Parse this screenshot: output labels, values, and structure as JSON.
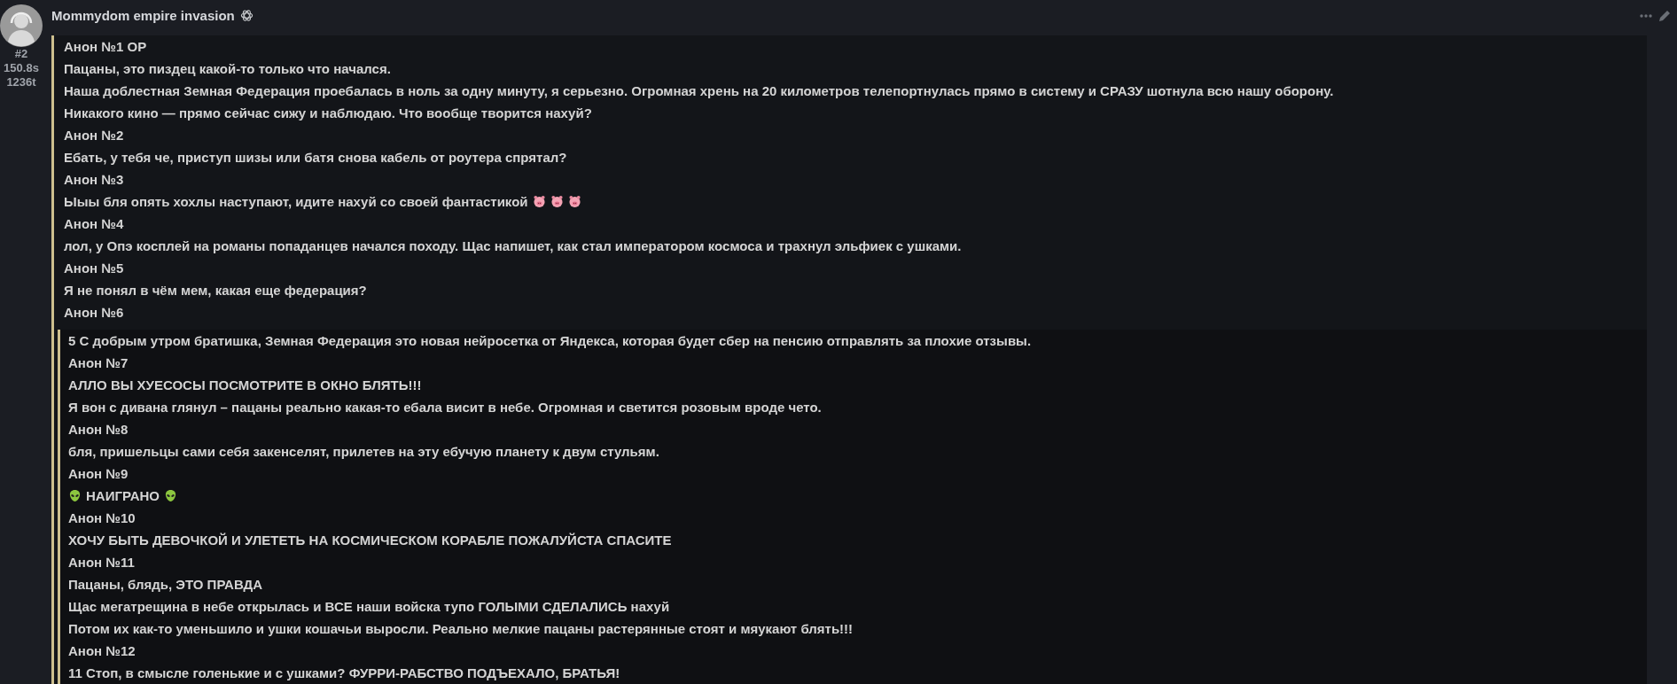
{
  "post": {
    "title": "Mommydom empire invasion",
    "meta": [
      "#2",
      "150.8s",
      "1236t"
    ],
    "lines": [
      {
        "kind": "plain",
        "text": "Анон №1 ОР"
      },
      {
        "kind": "plain",
        "text": "Пацаны, это пиздец какой-то только что начался."
      },
      {
        "kind": "plain",
        "text": "Наша доблестная Земная Федерация проебалась в ноль за одну минуту, я серьезно. Огромная хрень на 20 километров телепортнулась прямо в систему и СРАЗУ шотнула всю нашу оборону."
      },
      {
        "kind": "plain",
        "text": "Никакого кино — прямо сейчас сижу и наблюдаю. Что вообще творится нахуй?"
      },
      {
        "kind": "plain",
        "text": "Анон №2"
      },
      {
        "kind": "plain",
        "text": "Ебать, у тебя че, приступ шизы или батя снова кабель от роутера спрятал?"
      },
      {
        "kind": "plain",
        "text": "Анон №3"
      },
      {
        "kind": "pigs",
        "text": "Ыыы бля опять хохлы наступают, идите нахуй со своей фантастикой"
      },
      {
        "kind": "plain",
        "text": "Анон №4"
      },
      {
        "kind": "plain",
        "text": "лол, у Опэ косплей на романы попаданцев начался походу. Щас напишет, как стал императором космоса и трахнул эльфиек с ушками."
      },
      {
        "kind": "plain",
        "text": "Анон №5"
      },
      {
        "kind": "plain",
        "text": "Я не понял в чём мем, какая еще федерация?"
      },
      {
        "kind": "plain",
        "text": "Анон №6"
      }
    ],
    "quote": {
      "lines": [
        {
          "kind": "plain",
          "text": "5 С добрым утром братишка, Земная Федерация это новая нейросетка от Яндекса, которая будет сбер на пенсию отправлять за плохие отзывы."
        },
        {
          "kind": "plain",
          "text": "Анон №7"
        },
        {
          "kind": "plain",
          "text": "АЛЛО ВЫ ХУЕСОСЫ ПОСМОТРИТЕ В ОКНО БЛЯТЬ!!!"
        },
        {
          "kind": "plain",
          "text": "Я вон с дивана глянул – пацаны реально какая-то ебала висит в небе. Огромная и светится розовым вроде чето."
        },
        {
          "kind": "plain",
          "text": "Анон №8"
        },
        {
          "kind": "plain",
          "text": "бля, пришельцы сами себя закенселят, прилетев на эту ебучую планету к двум стульям."
        },
        {
          "kind": "plain",
          "text": "Анон №9"
        },
        {
          "kind": "aliens",
          "text": "НАИГРАНО"
        },
        {
          "kind": "plain",
          "text": "Анон №10"
        },
        {
          "kind": "plain",
          "text": "ХОЧУ БЫТЬ ДЕВОЧКОЙ И УЛЕТЕТЬ НА КОСМИЧЕСКОМ КОРАБЛЕ ПОЖАЛУЙСТА СПАСИТЕ"
        },
        {
          "kind": "plain",
          "text": "Анон №11"
        },
        {
          "kind": "plain",
          "text": "Пацаны, блядь, ЭТО ПРАВДА"
        },
        {
          "kind": "plain",
          "text": "Щас мегатрещина в небе открылась и ВСЕ наши войска тупо ГОЛЫМИ СДЕЛАЛИСЬ нахуй"
        },
        {
          "kind": "plain",
          "text": "Потом их как-то уменьшило и ушки кошачьи выросли. Реально мелкие пацаны растерянные стоят и мяукают блять!!!"
        },
        {
          "kind": "plain",
          "text": "Анон №12"
        },
        {
          "kind": "plain",
          "text": "11 Стоп, в смысле голенькие и с ушками? ФУРРИ-РАБСТВО ПОДЪЕХАЛО, БРАТЬЯ!"
        }
      ]
    }
  }
}
